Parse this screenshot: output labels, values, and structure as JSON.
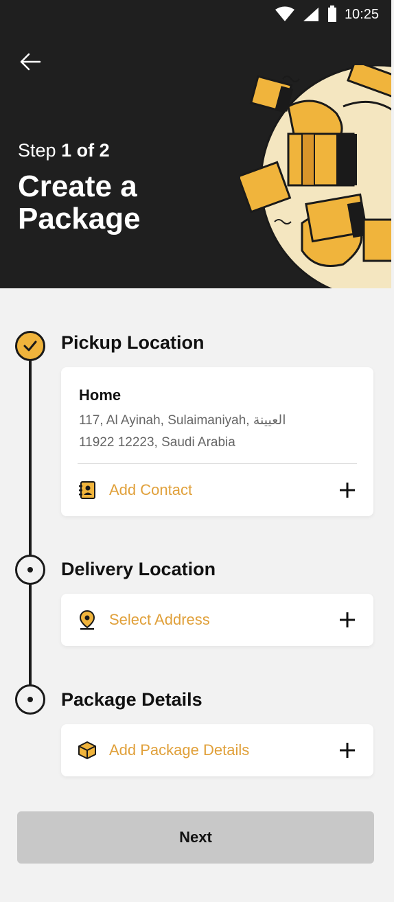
{
  "status_bar": {
    "time": "10:25"
  },
  "header": {
    "step_prefix": "Step",
    "step_value": "1 of 2",
    "title": "Create a Package"
  },
  "pickup": {
    "title": "Pickup Location",
    "address_name": "Home",
    "address_line1": "117, Al Ayinah, Sulaimaniyah, العيينة",
    "address_line2": "11922 12223, Saudi Arabia",
    "add_contact_label": "Add Contact"
  },
  "delivery": {
    "title": "Delivery Location",
    "select_address_label": "Select Address"
  },
  "package": {
    "title": "Package Details",
    "add_details_label": "Add Package Details"
  },
  "next_label": "Next",
  "colors": {
    "accent": "#e0a03a",
    "header_bg": "#1f1f1f",
    "check_fill": "#f0b43c",
    "button_disabled": "#c8c8c8"
  }
}
